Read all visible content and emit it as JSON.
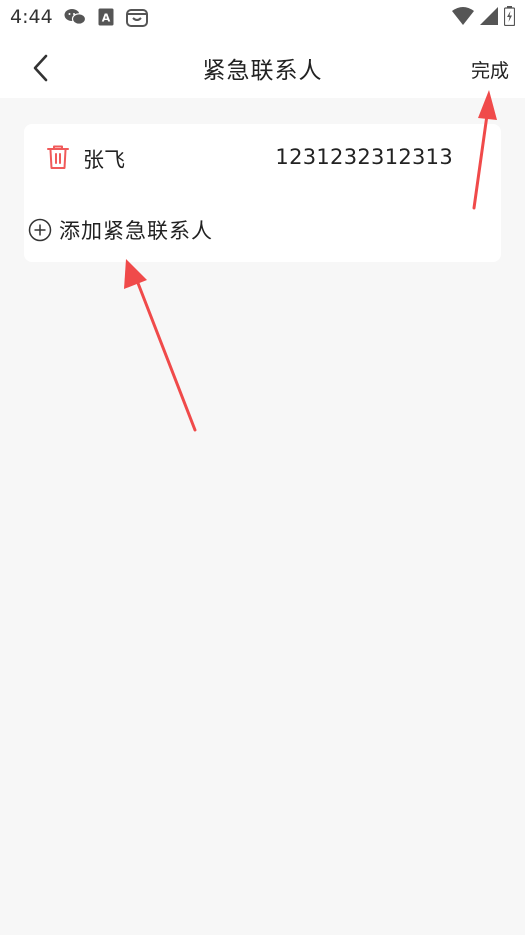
{
  "status_bar": {
    "time": "4:44",
    "left_icons": [
      "wechat-icon",
      "a-badge-icon",
      "store-icon"
    ],
    "right_icons": [
      "wifi-icon",
      "signal-icon",
      "battery-icon"
    ]
  },
  "header": {
    "title": "紧急联系人",
    "done_label": "完成",
    "back_icon": "chevron-left-icon"
  },
  "contacts": [
    {
      "name": "张飞",
      "phone": "1231232312313",
      "delete_icon": "trash-icon"
    }
  ],
  "add_contact": {
    "label": "添加紧急联系人",
    "icon": "plus-circle-icon"
  },
  "colors": {
    "accent_red": "#f05a5a",
    "arrow_red": "#f04a4a",
    "page_bg": "#f7f7f7",
    "card_bg": "#ffffff"
  }
}
